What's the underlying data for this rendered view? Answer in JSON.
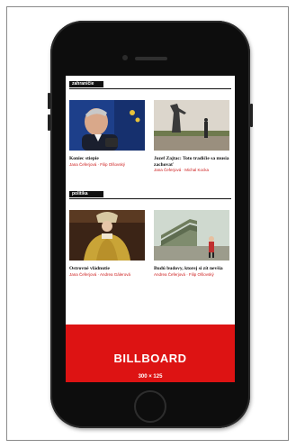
{
  "sections": [
    {
      "tag": "zahraničie",
      "articles": [
        {
          "title": "Koniec stiepie",
          "authors": "Jana Čeferjová · Filip Olšovský",
          "image": "portrait-man-photo"
        },
        {
          "title": "Jozef Zajtac: Toto tradičie sa musia zachovať",
          "authors": "Jana Čeferjová · Michal Kocka",
          "image": "statue-photo"
        }
      ]
    },
    {
      "tag": "politika",
      "articles": [
        {
          "title": "Ostrovné vládnutie",
          "authors": "Jana Čeferjová · Andrea Gálerová",
          "image": "queen-painting-photo"
        },
        {
          "title": "Budú budovy, ktorej si zít nevšia",
          "authors": "Andrea Čeferjová · Filip Olšovský",
          "image": "building-photo"
        }
      ]
    }
  ],
  "billboard": {
    "title": "BILLBOARD",
    "size": "300 × 125"
  },
  "colors": {
    "accent": "#dd1313",
    "author": "#cc1a1a",
    "phone": "#0d0d0d"
  }
}
